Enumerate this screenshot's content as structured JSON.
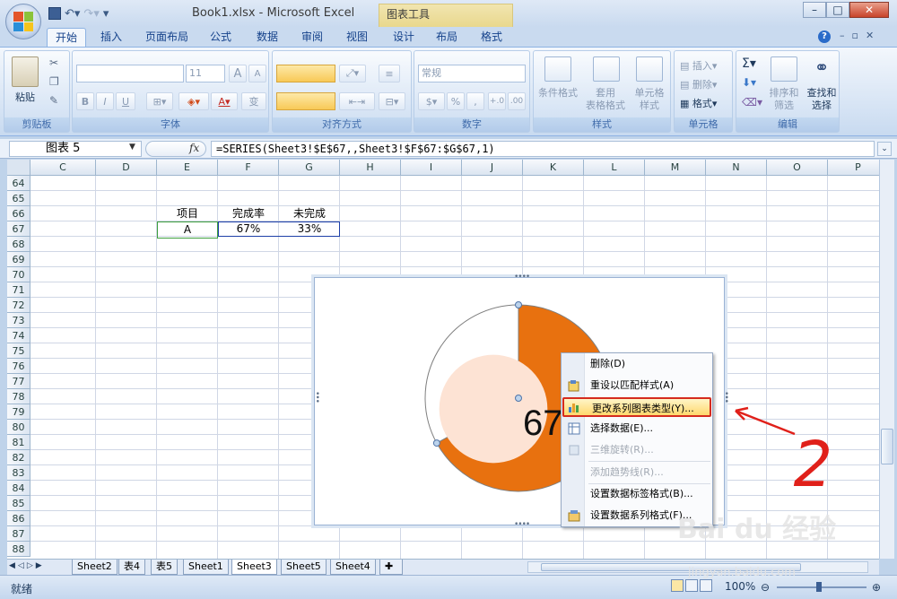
{
  "window": {
    "title": "Book1.xlsx - Microsoft Excel",
    "context_tab_group": "图表工具"
  },
  "tabs": [
    {
      "label": "开始",
      "active": true
    },
    {
      "label": "插入"
    },
    {
      "label": "页面布局"
    },
    {
      "label": "公式"
    },
    {
      "label": "数据"
    },
    {
      "label": "审阅"
    },
    {
      "label": "视图"
    },
    {
      "label": "设计"
    },
    {
      "label": "布局"
    },
    {
      "label": "格式"
    }
  ],
  "ribbon": {
    "clipboard": {
      "title": "剪贴板",
      "paste": "粘贴"
    },
    "font": {
      "title": "字体",
      "size": "11",
      "bold": "B",
      "italic": "I",
      "underline": "U",
      "grow": "A",
      "shrink": "A",
      "wen": "变"
    },
    "alignment": {
      "title": "对齐方式"
    },
    "number": {
      "title": "数字",
      "format": "常规",
      "percent": "%",
      "comma": ",",
      "inc": "+.0",
      "dec": ".00"
    },
    "styles": {
      "title": "样式",
      "conditional": "条件格式",
      "table_line1": "套用",
      "table_line2": "表格格式",
      "cell_line1": "单元格",
      "cell_line2": "样式"
    },
    "cells": {
      "title": "单元格",
      "insert": "插入",
      "delete": "删除",
      "format": "格式"
    },
    "editing": {
      "title": "编辑",
      "sum": "Σ",
      "sort_line1": "排序和",
      "sort_line2": "筛选",
      "find_line1": "查找和",
      "find_line2": "选择"
    }
  },
  "formula_bar": {
    "name_box": "图表 5",
    "fx": "fx",
    "formula": "=SERIES(Sheet3!$E$67,,Sheet3!$F$67:$G$67,1)"
  },
  "columns": [
    "C",
    "D",
    "E",
    "F",
    "G",
    "H",
    "I",
    "J",
    "K",
    "L",
    "M",
    "N",
    "O",
    "P"
  ],
  "rows": [
    "64",
    "65",
    "66",
    "67",
    "68",
    "69",
    "70",
    "71",
    "72",
    "73",
    "74",
    "75",
    "76",
    "77",
    "78",
    "79",
    "80",
    "81",
    "82",
    "83",
    "84",
    "85",
    "86",
    "87",
    "88"
  ],
  "cells": {
    "E66": "项目",
    "F66": "完成率",
    "G66": "未完成",
    "E67": "A",
    "F67": "67%",
    "G67": "33%"
  },
  "chart_data": {
    "type": "pie",
    "series": [
      {
        "name": "A",
        "values": [
          67,
          33
        ]
      }
    ],
    "categories": [
      "完成率",
      "未完成"
    ],
    "colors": [
      "#e8710f",
      "#ffffff"
    ],
    "inner_circle_color": "#fde3d4",
    "center_label": "67"
  },
  "context_menu": {
    "items": [
      {
        "label": "删除(D)",
        "enabled": true,
        "icon": null
      },
      {
        "label": "重设以匹配样式(A)",
        "enabled": true,
        "icon": "reset-style-icon"
      },
      {
        "label": "更改系列图表类型(Y)...",
        "enabled": true,
        "icon": "chart-type-icon",
        "highlighted": true
      },
      {
        "label": "选择数据(E)...",
        "enabled": true,
        "icon": "select-data-icon"
      },
      {
        "label": "三维旋转(R)...",
        "enabled": false,
        "icon": "3d-rotate-icon"
      },
      {
        "label": "添加趋势线(R)...",
        "enabled": false,
        "icon": null
      },
      {
        "label": "设置数据标签格式(B)...",
        "enabled": true,
        "icon": null
      },
      {
        "label": "设置数据系列格式(F)...",
        "enabled": true,
        "icon": "format-series-icon"
      }
    ]
  },
  "annotation": {
    "number": "2",
    "color": "#e0201a"
  },
  "sheets": [
    "Sheet2",
    "表4",
    "表5",
    "Sheet1",
    "Sheet3",
    "Sheet5",
    "Sheet4"
  ],
  "active_sheet": "Sheet3",
  "status": {
    "mode": "就绪",
    "zoom": "100%"
  },
  "watermark": {
    "brand": "Bai du 经验",
    "url": "jingyan.baidu.com"
  }
}
